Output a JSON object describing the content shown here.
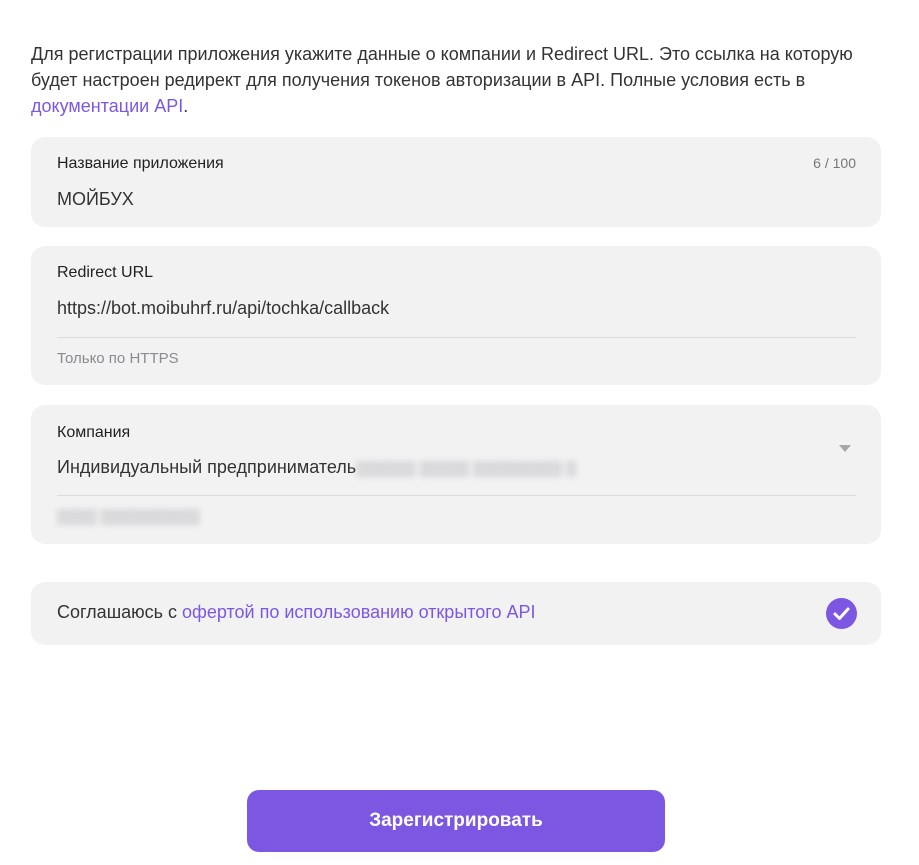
{
  "intro": {
    "text_before": "Для регистрации приложения укажите данные о компании и Redirect URL. Это ссылка на которую будет настроен редирект для получения токенов авторизации в API. Полные условия есть в ",
    "link_text": "документации API",
    "text_after": "."
  },
  "app_name": {
    "label": "Название приложения",
    "value": "МОЙБУХ",
    "counter": "6 / 100"
  },
  "redirect_url": {
    "label": "Redirect URL",
    "value": "https://bot.moibuhrf.ru/api/tochka/callback",
    "hint": "Только по HTTPS"
  },
  "company": {
    "label": "Компания",
    "value": "Индивидуальный предприниматель",
    "icon": "chevron-down-icon"
  },
  "agreement": {
    "text": "Соглашаюсь с ",
    "link_text": "офертой по использованию открытого API",
    "checked": true,
    "icon": "checkmark-icon"
  },
  "submit": {
    "label": "Зарегистрировать"
  },
  "colors": {
    "accent": "#7b57e2",
    "card_bg": "#f2f2f3",
    "text": "#333333",
    "muted": "#8a8a8f"
  }
}
